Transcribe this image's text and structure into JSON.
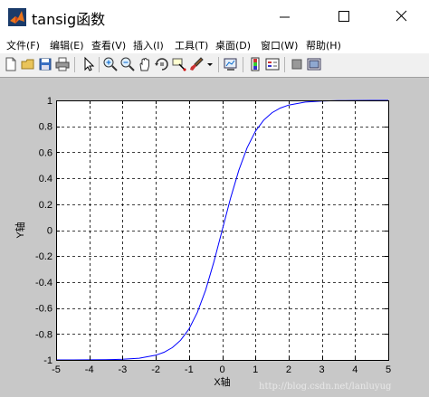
{
  "window": {
    "title": "tansig函数",
    "controls": [
      "minimize",
      "maximize",
      "close"
    ]
  },
  "menu": {
    "items": [
      "文件(F)",
      "编辑(E)",
      "查看(V)",
      "插入(I)",
      "工具(T)",
      "桌面(D)",
      "窗口(W)",
      "帮助(H)"
    ]
  },
  "toolbar": {
    "icons": [
      "new-figure-icon",
      "open-file-icon",
      "save-icon",
      "print-icon",
      "pointer-icon",
      "zoom-in-icon",
      "zoom-out-icon",
      "pan-icon",
      "rotate-3d-icon",
      "data-cursor-icon",
      "brush-icon",
      "link-plot-icon",
      "colorbar-icon",
      "legend-icon",
      "hide-plot-tools-icon",
      "show-plot-tools-icon"
    ]
  },
  "watermark": "http://blog.csdn.net/lanluyug",
  "chart_data": {
    "type": "line",
    "title": "",
    "xlabel": "X轴",
    "ylabel": "Y轴",
    "xlim": [
      -5,
      5
    ],
    "ylim": [
      -1,
      1
    ],
    "xticks": [
      -5,
      -4,
      -3,
      -2,
      -1,
      0,
      1,
      2,
      3,
      4,
      5
    ],
    "yticks": [
      -1,
      -0.8,
      -0.6,
      -0.4,
      -0.2,
      0,
      0.2,
      0.4,
      0.6,
      0.8,
      1
    ],
    "xtick_labels": [
      "-5",
      "-4",
      "-3",
      "-2",
      "-1",
      "0",
      "1",
      "2",
      "3",
      "4",
      "5"
    ],
    "ytick_labels": [
      "-1",
      "-0.8",
      "-0.6",
      "-0.4",
      "-0.2",
      "0",
      "0.2",
      "0.4",
      "0.6",
      "0.8",
      "1"
    ],
    "grid": true,
    "grid_style": "dashed",
    "line_color": "#0000ff",
    "series": [
      {
        "x": [
          -5,
          -4.5,
          -4,
          -3.5,
          -3,
          -2.5,
          -2,
          -1.75,
          -1.5,
          -1.25,
          -1,
          -0.75,
          -0.5,
          -0.25,
          0,
          0.25,
          0.5,
          0.75,
          1,
          1.25,
          1.5,
          1.75,
          2,
          2.5,
          3,
          3.5,
          4,
          4.5,
          5
        ],
        "y": [
          -1,
          -1,
          -0.999,
          -0.998,
          -0.995,
          -0.987,
          -0.964,
          -0.941,
          -0.905,
          -0.848,
          -0.762,
          -0.635,
          -0.462,
          -0.245,
          0,
          0.245,
          0.462,
          0.635,
          0.762,
          0.848,
          0.905,
          0.941,
          0.964,
          0.987,
          0.995,
          0.998,
          0.999,
          1,
          1
        ]
      }
    ]
  }
}
